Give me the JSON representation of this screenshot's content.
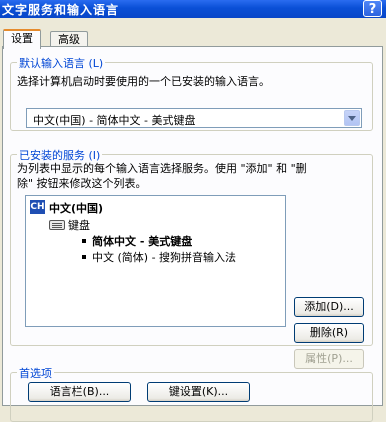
{
  "window": {
    "title": "文字服务和输入语言",
    "help": "?"
  },
  "tabs": [
    {
      "label": "设置",
      "active": true
    },
    {
      "label": "高级",
      "active": false
    }
  ],
  "default_language": {
    "legend": "默认输入语言 (L)",
    "description": "选择计算机启动时要使用的一个已安装的输入语言。",
    "selected": "中文(中国) - 简体中文 - 美式键盘"
  },
  "installed_services": {
    "legend": "已安装的服务 (I)",
    "description_line1": "为列表中显示的每个输入语言选择服务。使用 \"添加\" 和 \"删",
    "description_line2": "除\" 按钮来修改这个列表。",
    "tree": {
      "language_badge": "CH",
      "language": "中文(中国)",
      "category": "键盘",
      "items": [
        {
          "label": "简体中文 - 美式键盘",
          "selected": true
        },
        {
          "label": "中文 (简体) - 搜狗拼音输入法",
          "selected": false
        }
      ]
    },
    "buttons": {
      "add": "添加(D)...",
      "remove": "删除(R)",
      "properties": "属性(P)..."
    }
  },
  "preferences": {
    "legend": "首选项",
    "language_bar": "语言栏(B)...",
    "key_settings": "键设置(K)..."
  }
}
